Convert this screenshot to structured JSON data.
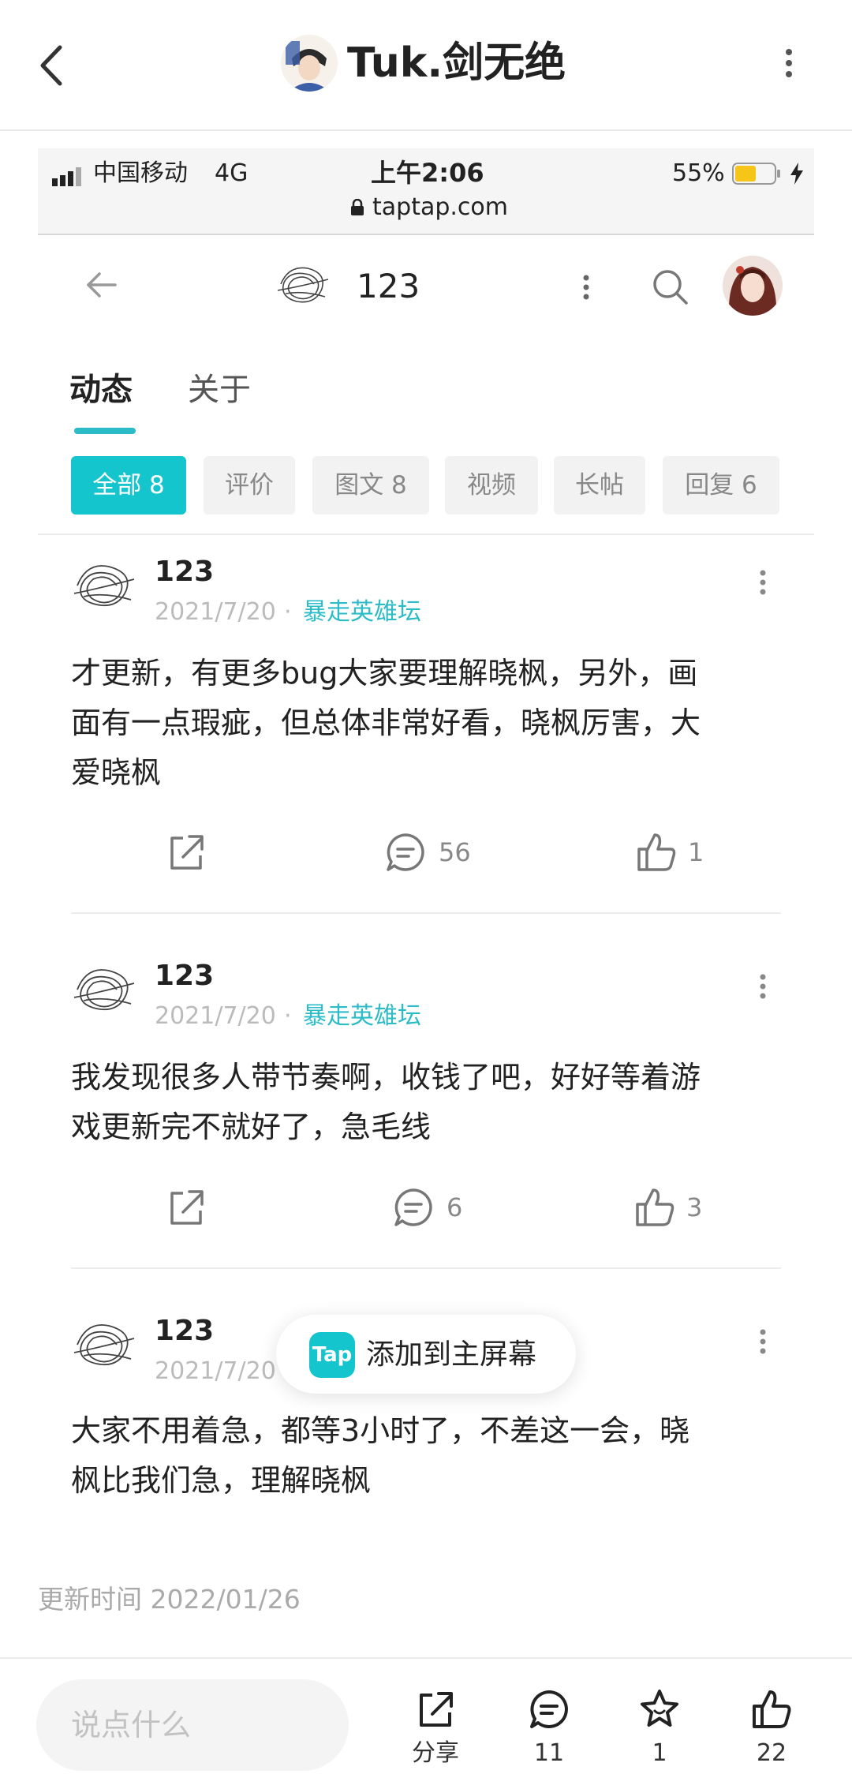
{
  "app_header": {
    "title": "Tuk.剑无绝"
  },
  "status_bar": {
    "carrier": "中国移动",
    "network": "4G",
    "time": "上午2:06",
    "url": "taptap.com",
    "battery_percent": "55%",
    "battery_level": 0.55
  },
  "site_nav": {
    "username": "123"
  },
  "tabs": [
    {
      "label": "动态",
      "active": true
    },
    {
      "label": "关于",
      "active": false
    }
  ],
  "filters": [
    {
      "label": "全部 8",
      "active": true
    },
    {
      "label": "评价",
      "active": false
    },
    {
      "label": "图文 8",
      "active": false
    },
    {
      "label": "视频",
      "active": false
    },
    {
      "label": "长帖",
      "active": false
    },
    {
      "label": "回复 6",
      "active": false
    }
  ],
  "posts": [
    {
      "author": "123",
      "date": "2021/7/20",
      "forum": "暴走英雄坛",
      "text_lines": [
        "才更新，有更多bug大家要理解晓枫，另外，画",
        "面有一点瑕疵，但总体非常好看，晓枫厉害，大",
        "爱晓枫"
      ],
      "comments": "56",
      "likes": "1"
    },
    {
      "author": "123",
      "date": "2021/7/20",
      "forum": "暴走英雄坛",
      "text_lines": [
        "我发现很多人带节奏啊，收钱了吧，好好等着游",
        "戏更新完不就好了，急毛线"
      ],
      "comments": "6",
      "likes": "3"
    },
    {
      "author": "123",
      "date": "2021/7/20",
      "text_lines": [
        "大家不用着急，都等3小时了，不差这一会，晓",
        "枫比我们急，理解晓枫"
      ]
    }
  ],
  "toast": {
    "logo_text": "Tap",
    "label": "添加到主屏幕"
  },
  "update_time": "更新时间 2022/01/26",
  "bottom_bar": {
    "input_placeholder": "说点什么",
    "share_label": "分享",
    "comment_count": "11",
    "favorite_count": "1",
    "like_count": "22"
  },
  "colors": {
    "accent": "#15c5ce",
    "forum_link": "#2bbcc7",
    "battery": "#f5c518"
  },
  "icons": [
    "back-arrow-icon",
    "more-vertical-icon",
    "signal-icon",
    "lock-icon",
    "battery-icon",
    "charging-bolt-icon",
    "search-icon",
    "share-icon",
    "comment-icon",
    "like-icon",
    "star-icon"
  ]
}
